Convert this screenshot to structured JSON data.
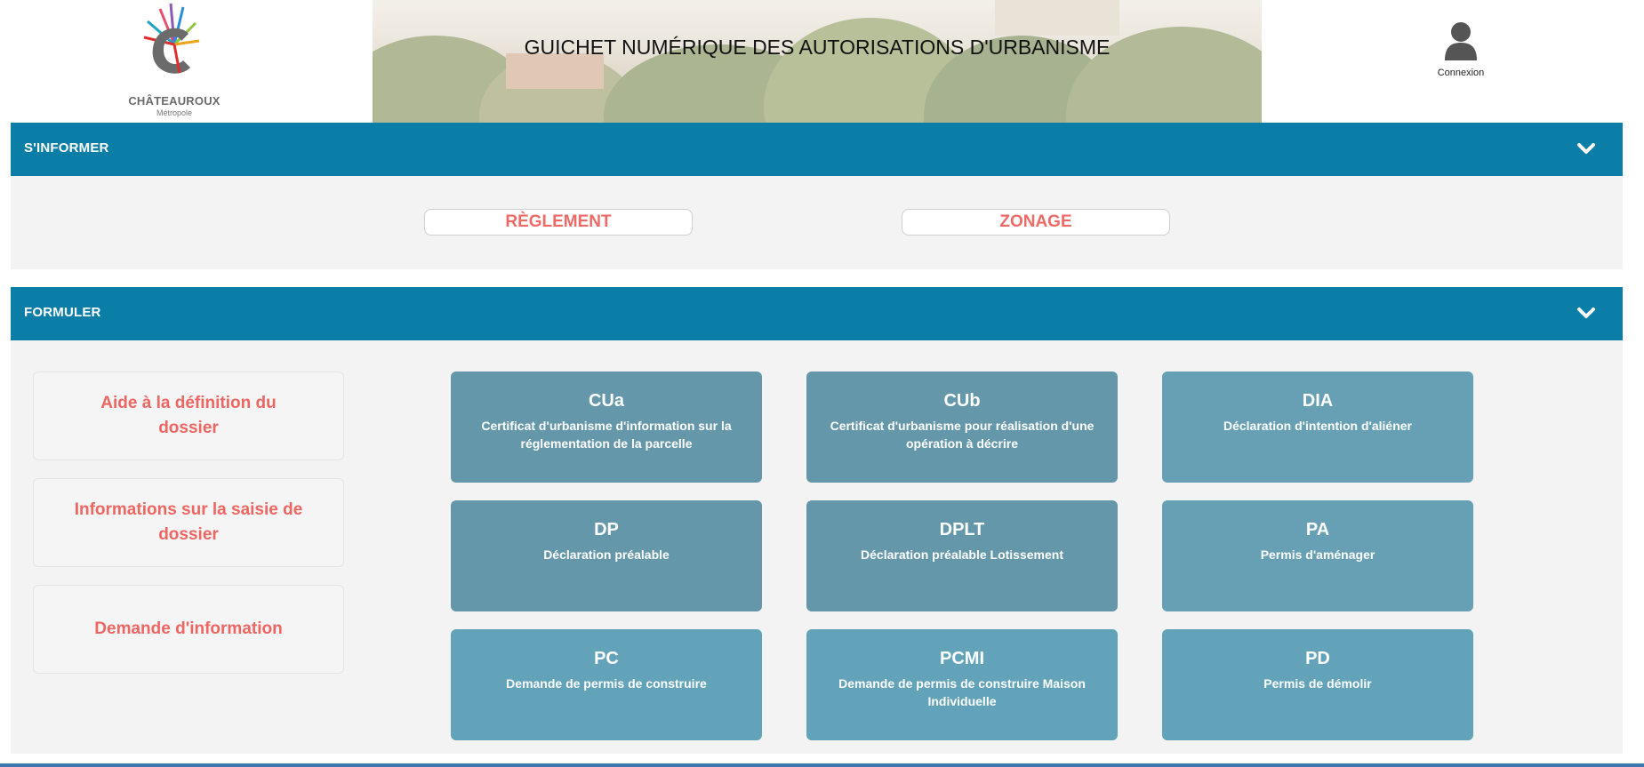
{
  "logo": {
    "name": "CHÂTEAUROUX",
    "sub": "Métropole"
  },
  "header": {
    "title": "GUICHET NUMÉRIQUE DES AUTORISATIONS D'URBANISME"
  },
  "account": {
    "label": "Connexion",
    "icon": "user-icon"
  },
  "inform": {
    "title": "S'INFORMER",
    "buttons": [
      {
        "label": "RÈGLEMENT"
      },
      {
        "label": "ZONAGE"
      }
    ]
  },
  "formulate": {
    "title": "FORMULER",
    "side_links": [
      {
        "label": "Aide à la définition du dossier"
      },
      {
        "label": "Informations sur la saisie de dossier"
      },
      {
        "label": "Demande d'information"
      }
    ],
    "tiles": [
      {
        "code": "CUa",
        "desc": "Certificat d'urbanisme d'information sur la réglementation de la parcelle",
        "color": "#6597aa"
      },
      {
        "code": "CUb",
        "desc": "Certificat d'urbanisme pour réalisation d'une opération à décrire",
        "color": "#6597aa"
      },
      {
        "code": "DIA",
        "desc": "Déclaration d'intention d'aliéner",
        "color": "#67a0b5"
      },
      {
        "code": "DP",
        "desc": "Déclaration préalable",
        "color": "#6597aa"
      },
      {
        "code": "DPLT",
        "desc": "Déclaration préalable Lotissement",
        "color": "#6597aa"
      },
      {
        "code": "PA",
        "desc": "Permis d'aménager",
        "color": "#67a0b5"
      },
      {
        "code": "PC",
        "desc": "Demande de permis de construire",
        "color": "#62a3ba"
      },
      {
        "code": "PCMI",
        "desc": "Demande de permis de construire Maison Individuelle",
        "color": "#62a3ba"
      },
      {
        "code": "PD",
        "desc": "Permis de démolir",
        "color": "#62a3ba"
      }
    ]
  },
  "colors": {
    "bar": "#0b7ea8",
    "accent_text": "#ee6662",
    "body_bg": "#f3f3f3"
  }
}
